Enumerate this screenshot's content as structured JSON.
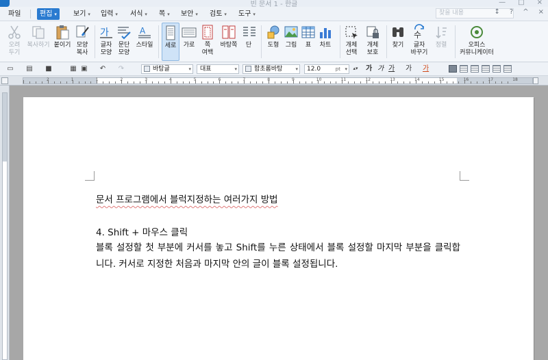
{
  "window": {
    "title": "빈 문서 1 - 한글",
    "controls": [
      "—",
      "□",
      "×"
    ]
  },
  "menu": {
    "items": [
      {
        "label": "파일",
        "arrow": false
      },
      {
        "label": "편집",
        "arrow": true,
        "active": true
      },
      {
        "label": "보기",
        "arrow": true
      },
      {
        "label": "입력",
        "arrow": true
      },
      {
        "label": "서식",
        "arrow": true
      },
      {
        "label": "쪽",
        "arrow": true
      },
      {
        "label": "보안",
        "arrow": true
      },
      {
        "label": "검토",
        "arrow": true
      },
      {
        "label": "도구",
        "arrow": true
      }
    ],
    "arrow_glyph": "▾",
    "search_placeholder": "찾을 내용",
    "right_controls": [
      "↕",
      "?",
      "^",
      "×"
    ]
  },
  "ribbon": {
    "buttons": [
      {
        "id": "cut",
        "label1": "오려",
        "label2": "두기",
        "icon": "scissors-icon",
        "disabled": true
      },
      {
        "id": "copy",
        "label1": "복사하기",
        "label2": "",
        "icon": "copy-icon",
        "disabled": true
      },
      {
        "id": "paste",
        "label1": "붙이기",
        "label2": "",
        "icon": "clipboard-icon",
        "dropdown": true
      },
      {
        "id": "format-copy",
        "label1": "모양",
        "label2": "복사",
        "icon": "format-paint-icon"
      },
      {
        "id": "char-shape",
        "label1": "글자",
        "label2": "모양",
        "icon": "char-shape-icon"
      },
      {
        "id": "para-shape",
        "label1": "문단",
        "label2": "모양",
        "icon": "para-shape-icon"
      },
      {
        "id": "style",
        "label1": "스타일",
        "label2": "",
        "icon": "style-icon",
        "dropdown": true
      },
      {
        "id": "portrait",
        "label1": "세로",
        "label2": "",
        "icon": "portrait-icon",
        "selected": true
      },
      {
        "id": "landscape",
        "label1": "가로",
        "label2": "",
        "icon": "landscape-icon"
      },
      {
        "id": "page-margin",
        "label1": "쪽",
        "label2": "여백",
        "icon": "page-margin-icon",
        "dropdown": true
      },
      {
        "id": "background",
        "label1": "바탕쪽",
        "label2": "",
        "icon": "background-page-icon"
      },
      {
        "id": "columns",
        "label1": "단",
        "label2": "",
        "icon": "columns-icon",
        "dropdown": true
      },
      {
        "id": "shape",
        "label1": "도형",
        "label2": "",
        "icon": "shapes-icon",
        "dropdown": true
      },
      {
        "id": "picture",
        "label1": "그림",
        "label2": "",
        "icon": "picture-icon",
        "dropdown": true
      },
      {
        "id": "table",
        "label1": "표",
        "label2": "",
        "icon": "table-icon",
        "dropdown": true
      },
      {
        "id": "chart",
        "label1": "차트",
        "label2": "",
        "icon": "chart-icon",
        "dropdown": true
      },
      {
        "id": "select-obj",
        "label1": "개체",
        "label2": "선택",
        "icon": "select-object-icon",
        "dropdown": true
      },
      {
        "id": "protect-obj",
        "label1": "개체",
        "label2": "보호",
        "icon": "lock-icon",
        "dropdown": true
      },
      {
        "id": "find",
        "label1": "찾기",
        "label2": "",
        "icon": "binoculars-icon",
        "dropdown": true
      },
      {
        "id": "replace",
        "label1": "글자",
        "label2": "바꾸기",
        "icon": "replace-icon",
        "dropdown": true
      },
      {
        "id": "align",
        "label1": "정렬",
        "label2": "",
        "icon": "sort-icon",
        "disabled": true
      },
      {
        "id": "communicator",
        "label1": "오피스",
        "label2": "커뮤니케이터",
        "icon": "communicator-icon"
      }
    ]
  },
  "format_toolbar": {
    "style_name": "바탕글",
    "lang": "대표",
    "font": "함초롬바탕",
    "size": "12.0",
    "unit": "pt",
    "char_buttons": [
      "가",
      "가",
      "가",
      "가",
      "가"
    ]
  },
  "ruler": {
    "numbers": [
      "2",
      "1",
      "1",
      "2",
      "3",
      "4",
      "5",
      "6",
      "7",
      "8",
      "9",
      "10",
      "11",
      "12",
      "13",
      "14",
      "15",
      "16",
      "17",
      "18"
    ]
  },
  "document": {
    "title": "문서 프로그램에서 블럭지정하는 여러가지 방법",
    "heading": "4. Shift + 마우스 클릭",
    "body": "블록 설정할 첫 부분에 커서를 놓고 Shift를 누른 상태에서 블록 설정할 마지막 부분을 클릭합니다. 커서로 지정한 처음과 마지막 안의 글이 블록 설정됩니다."
  },
  "colors": {
    "accent": "#2a7bd0",
    "ribbon_bg": "#f3f6fa",
    "canvas": "#a7a7a7"
  }
}
